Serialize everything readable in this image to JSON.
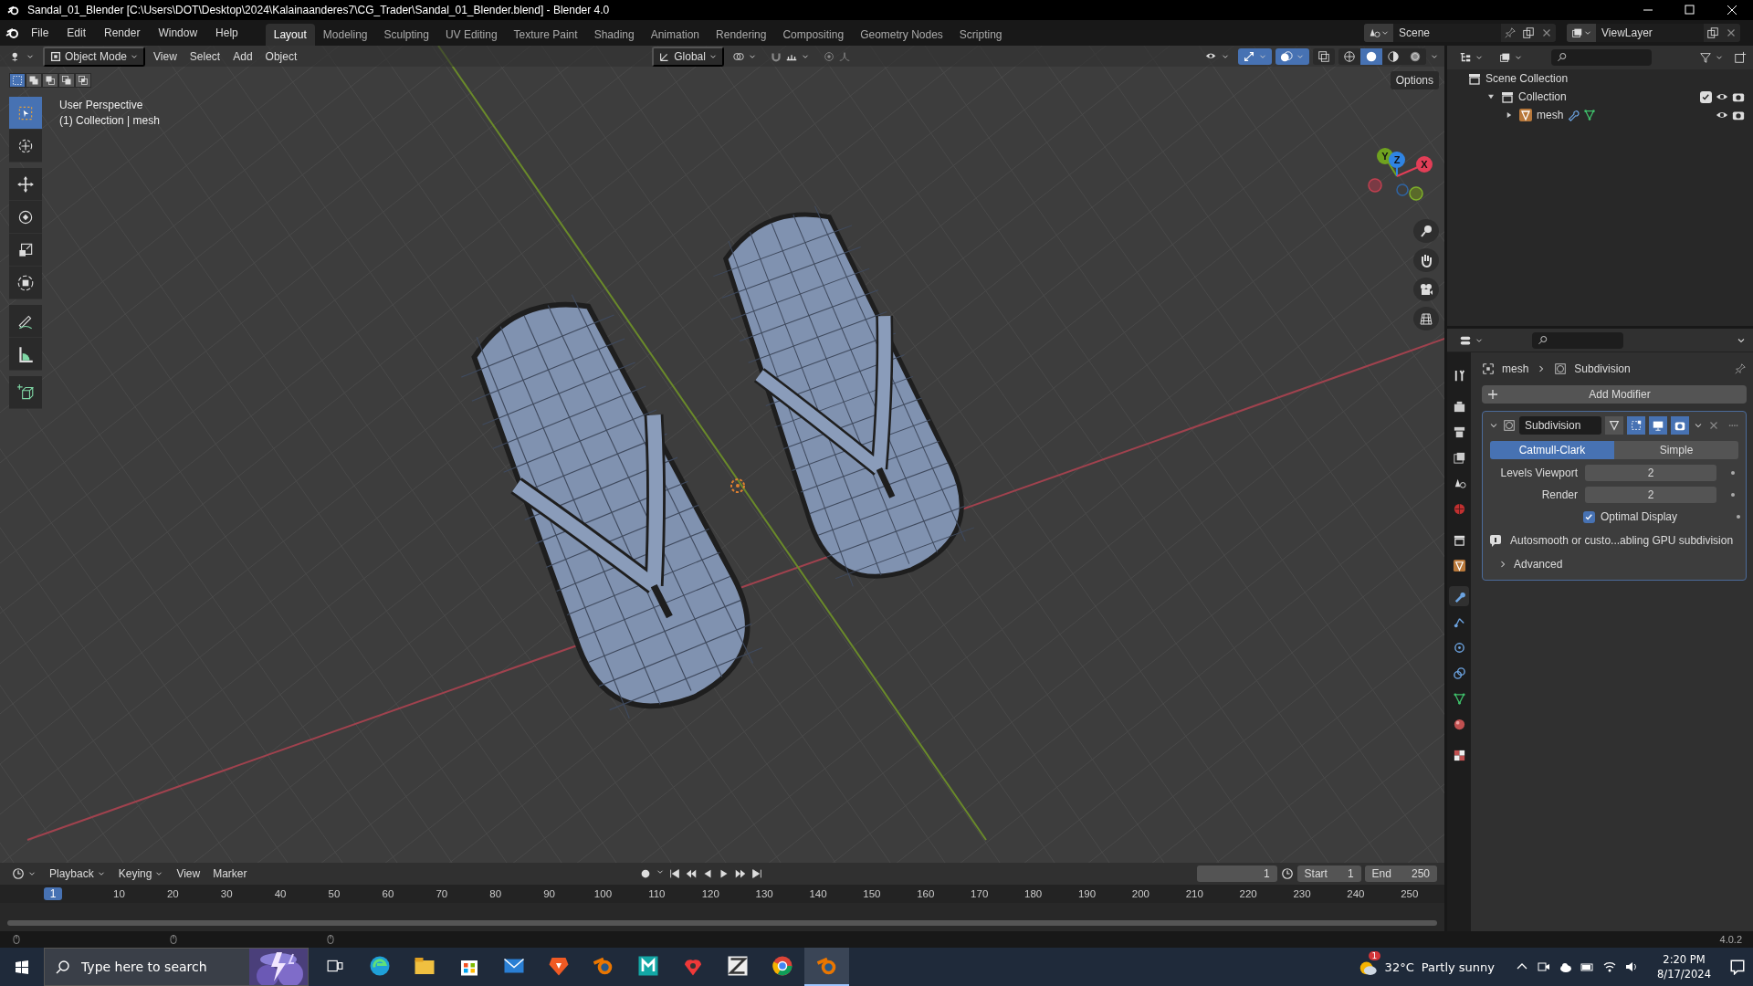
{
  "window": {
    "title": "Sandal_01_Blender [C:\\Users\\DOT\\Desktop\\2024\\Kalainaanderes7\\CG_Trader\\Sandal_01_Blender.blend] - Blender 4.0"
  },
  "menu": [
    "File",
    "Edit",
    "Render",
    "Window",
    "Help"
  ],
  "workspaces": [
    {
      "label": "Layout",
      "selected": true
    },
    {
      "label": "Modeling",
      "selected": false
    },
    {
      "label": "Sculpting",
      "selected": false
    },
    {
      "label": "UV Editing",
      "selected": false
    },
    {
      "label": "Texture Paint",
      "selected": false
    },
    {
      "label": "Shading",
      "selected": false
    },
    {
      "label": "Animation",
      "selected": false
    },
    {
      "label": "Rendering",
      "selected": false
    },
    {
      "label": "Compositing",
      "selected": false
    },
    {
      "label": "Geometry Nodes",
      "selected": false
    },
    {
      "label": "Scripting",
      "selected": false
    }
  ],
  "scene": {
    "name": "Scene"
  },
  "view_layer": {
    "name": "ViewLayer"
  },
  "viewport_header": {
    "mode": "Object Mode",
    "menus": [
      "View",
      "Select",
      "Add",
      "Object"
    ],
    "orientation": "Global",
    "gizmos": {
      "on": true
    },
    "overlays": {
      "on": true
    },
    "xray": {
      "on": false
    },
    "shading": [
      {
        "kind": "wireframe",
        "selected": false
      },
      {
        "kind": "solid",
        "selected": true
      },
      {
        "kind": "material",
        "selected": false
      },
      {
        "kind": "rendered",
        "selected": false
      }
    ]
  },
  "select_modes": [
    {
      "kind": "new",
      "selected": true
    },
    {
      "kind": "extend",
      "selected": false
    },
    {
      "kind": "subtract",
      "selected": false
    },
    {
      "kind": "invert",
      "selected": false
    },
    {
      "kind": "intersect",
      "selected": false
    }
  ],
  "viewport": {
    "overlay_text": [
      "User Perspective",
      "(1) Collection | mesh"
    ],
    "options": "Options",
    "axes": [
      {
        "label": "Y",
        "color": "#6fa21f"
      },
      {
        "label": "Z",
        "color": "#2f84e3"
      },
      {
        "label": "X",
        "color": "#e23e57"
      }
    ]
  },
  "tools": [
    {
      "kind": "select_box",
      "selected": true
    },
    {
      "kind": "cursor",
      "selected": false
    },
    {
      "kind": "move",
      "selected": false
    },
    {
      "kind": "rotate",
      "selected": false
    },
    {
      "kind": "scale",
      "selected": false
    },
    {
      "kind": "transform",
      "selected": false
    },
    {
      "kind": "annotate",
      "selected": false
    },
    {
      "kind": "measure",
      "selected": false
    },
    {
      "kind": "add_cube",
      "selected": false
    }
  ],
  "outliner": {
    "tree": [
      {
        "label": "Scene Collection",
        "kind": "scene_collection",
        "children": [
          {
            "label": "Collection",
            "kind": "collection",
            "expanded": true,
            "checked": true,
            "children": [
              {
                "label": "mesh",
                "kind": "object",
                "expanded": false
              }
            ]
          }
        ]
      }
    ]
  },
  "properties": {
    "tabs": [
      {
        "kind": "tool",
        "selected": false
      },
      {
        "kind": "render",
        "selected": false
      },
      {
        "kind": "output",
        "selected": false
      },
      {
        "kind": "view_layer",
        "selected": false
      },
      {
        "kind": "scene",
        "selected": false
      },
      {
        "kind": "world",
        "selected": false
      },
      {
        "kind": "collection",
        "selected": false
      },
      {
        "kind": "object",
        "selected": false
      },
      {
        "kind": "modifier",
        "selected": true
      },
      {
        "kind": "particles",
        "selected": false
      },
      {
        "kind": "physics",
        "selected": false
      },
      {
        "kind": "constraints",
        "selected": false
      },
      {
        "kind": "data",
        "selected": false
      },
      {
        "kind": "material",
        "selected": false
      },
      {
        "kind": "texture",
        "selected": false
      }
    ],
    "breadcrumb": [
      "mesh",
      "Subdivision"
    ],
    "add_modifier": "Add Modifier",
    "modifier": {
      "name": "Subdivision",
      "expanded": true,
      "modes": [
        {
          "kind": "edit_cage",
          "on": false
        },
        {
          "kind": "edit_mode",
          "on": true
        },
        {
          "kind": "viewport",
          "on": true
        },
        {
          "kind": "render",
          "on": true
        }
      ],
      "types": [
        {
          "label": "Catmull-Clark",
          "selected": true
        },
        {
          "label": "Simple",
          "selected": false
        }
      ],
      "fields": [
        {
          "label": "Levels Viewport",
          "value": "2"
        },
        {
          "label": "Render",
          "value": "2"
        }
      ],
      "optimal_display": {
        "label": "Optimal Display",
        "checked": true
      },
      "info": "Autosmooth or custo...abling GPU subdivision",
      "advanced": {
        "label": "Advanced",
        "expanded": false
      }
    }
  },
  "timeline": {
    "menus": [
      "Playback",
      "Keying",
      "View",
      "Marker"
    ],
    "current_frame": "1",
    "start_label": "Start",
    "start": "1",
    "end_label": "End",
    "end": "250",
    "playhead": "1",
    "ticks": [
      "10",
      "20",
      "30",
      "40",
      "50",
      "60",
      "70",
      "80",
      "90",
      "100",
      "110",
      "120",
      "130",
      "140",
      "150",
      "160",
      "170",
      "180",
      "190",
      "200",
      "210",
      "220",
      "230",
      "240",
      "250"
    ]
  },
  "status_bar": {
    "version": "4.0.2"
  },
  "taskbar": {
    "search": {
      "placeholder": "Type here to search"
    },
    "apps": [
      {
        "kind": "task_view",
        "active": false
      },
      {
        "kind": "edge",
        "active": false
      },
      {
        "kind": "explorer",
        "active": false
      },
      {
        "kind": "store",
        "active": false
      },
      {
        "kind": "mail",
        "active": false
      },
      {
        "kind": "brave",
        "active": false
      },
      {
        "kind": "blender",
        "active": false
      },
      {
        "kind": "maya",
        "active": false
      },
      {
        "kind": "vivaldi",
        "active": false
      },
      {
        "kind": "zbrush",
        "active": false
      },
      {
        "kind": "chrome",
        "active": false
      },
      {
        "kind": "blender",
        "active": true
      }
    ],
    "weather": {
      "badge": "1",
      "temperature": "32°C",
      "condition": "Partly sunny"
    },
    "time": "2:20 PM",
    "date": "8/17/2024"
  }
}
